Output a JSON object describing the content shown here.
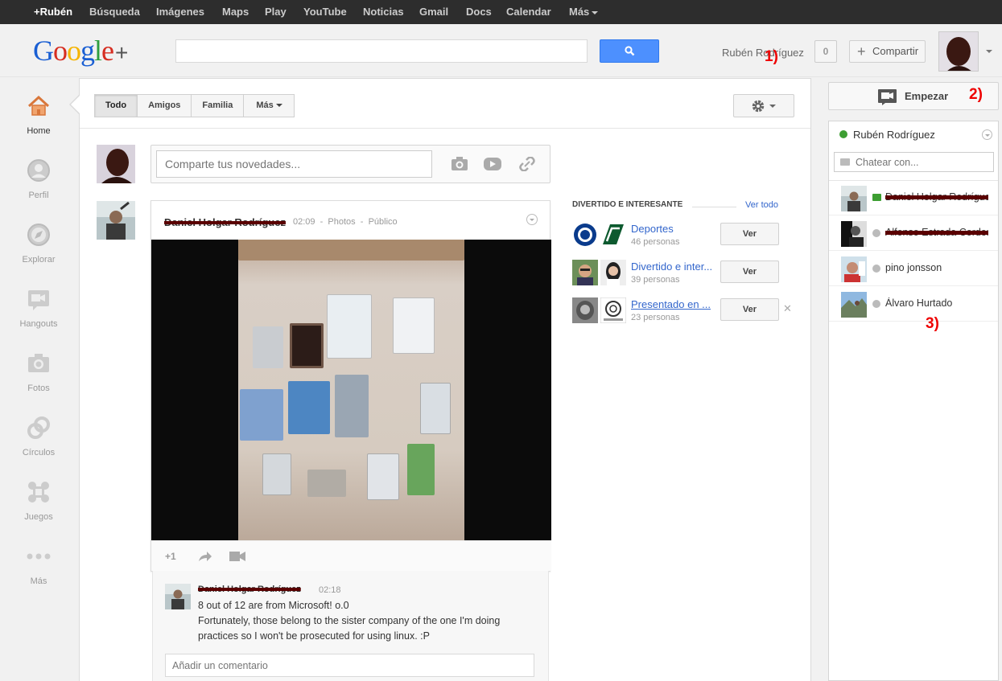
{
  "topbar": {
    "items": [
      "+Rubén",
      "Búsqueda",
      "Imágenes",
      "Maps",
      "Play",
      "YouTube",
      "Noticias",
      "Gmail",
      "Docs",
      "Calendar",
      "Más"
    ]
  },
  "header": {
    "logo_text": "Google",
    "logo_plus": "+",
    "user_name": "Rubén Rodríguez",
    "notification_count": "0",
    "share_label": "Compartir"
  },
  "annotations": {
    "a1": "1)",
    "a2": "2)",
    "a3": "3)"
  },
  "leftnav": {
    "items": [
      "Home",
      "Perfil",
      "Explorar",
      "Hangouts",
      "Fotos",
      "Círculos",
      "Juegos",
      "Más"
    ]
  },
  "filters": {
    "tabs": [
      "Todo",
      "Amigos",
      "Familia",
      "Más"
    ]
  },
  "sharebox": {
    "placeholder": "Comparte tus novedades..."
  },
  "post": {
    "author": "Daniel Holgar Rodríguez",
    "time": "02:09",
    "type": "Photos",
    "visibility": "Público",
    "plusone": "+1"
  },
  "comment": {
    "author": "Daniel Holgar Rodríguez",
    "time": "02:18",
    "line1": "8 out of 12 are from Microsoft! o.0",
    "line2": "Fortunately, those belong to the sister company of the one I'm doing practices so I won't be prosecuted for using linux. :P",
    "input_placeholder": "Añadir un comentario"
  },
  "suggestions": {
    "title": "DIVERTIDO E INTERESANTE",
    "see_all": "Ver todo",
    "items": [
      {
        "name": "Deportes",
        "count": "46 personas",
        "button": "Ver"
      },
      {
        "name": "Divertido e inter...",
        "count": "39 personas",
        "button": "Ver"
      },
      {
        "name": "Presentado en ...",
        "count": "23 personas",
        "button": "Ver"
      }
    ]
  },
  "hangout": {
    "button_label": "Empezar"
  },
  "chat": {
    "user": "Rubén Rodríguez",
    "search_placeholder": "Chatear con...",
    "contacts": [
      {
        "name": "Daniel Holgar Rodríguez"
      },
      {
        "name": "Alfonso Estrada Cordero"
      },
      {
        "name": "pino jonsson"
      },
      {
        "name": "Álvaro Hurtado"
      }
    ]
  },
  "colors": {
    "accent_blue": "#4d90fe",
    "link": "#3366cc",
    "online_green": "#3d9e32",
    "annotation_red": "#ee0000"
  }
}
